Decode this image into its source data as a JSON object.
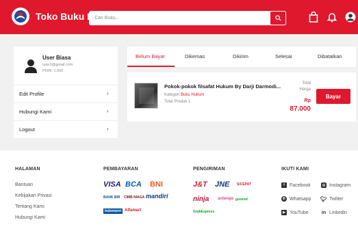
{
  "header": {
    "brand": "Toko Buku Budi",
    "search_placeholder": "Cari Buku..."
  },
  "user": {
    "name": "User Biasa",
    "email": "user1@gmail.com",
    "points": "POIN: 1,000"
  },
  "menu": [
    {
      "label": "Edit Profile"
    },
    {
      "label": "Hubungi Kami"
    },
    {
      "label": "Logout"
    }
  ],
  "tabs": [
    "Belum Bayar",
    "Dikemas",
    "Dikirim",
    "Selesai",
    "Dibatalkan"
  ],
  "order": {
    "title": "Pokok-pokok filsafat Hukum By Darji Darmodi...",
    "category_label": "Kategori",
    "category_value": "Buku Hukum",
    "qty": "Total Produk 1",
    "total_label_1": "Total",
    "total_label_2": "Harga",
    "currency": "Rp",
    "price": "87.000",
    "pay_label": "Bayar"
  },
  "footer": {
    "halaman_title": "HALAMAN",
    "halaman_links": [
      "Bantuan",
      "Kebijakan Privasi",
      "Tentang Kami",
      "Hubungi Kami"
    ],
    "pembayaran_title": "PEMBAYARAN",
    "payment_logos": {
      "visa": "VISA",
      "bca": "BCA",
      "bni": "BNI",
      "bri": "BANK BRI",
      "cimb": "CIMB NIAGA",
      "mandiri": "mandiri",
      "indomaret": "Indomaret",
      "alfamart": "Alfamart"
    },
    "pengiriman_title": "PENGIRIMAN",
    "courier_logos": {
      "jnt": "J&T",
      "jne": "JNE",
      "sicepat": "SiCEPAT",
      "ninja": "ninja",
      "anteraja": "anteraja",
      "gosend": "gosend",
      "grab": "GrabExpress"
    },
    "ikuti_title": "IKUTI KAMI",
    "socials": [
      "Facebook",
      "Instagram",
      "Whatsapp",
      "Twitter",
      "YouTube",
      "Linkedin"
    ]
  },
  "colors": {
    "brand_red": "#e0182d"
  }
}
